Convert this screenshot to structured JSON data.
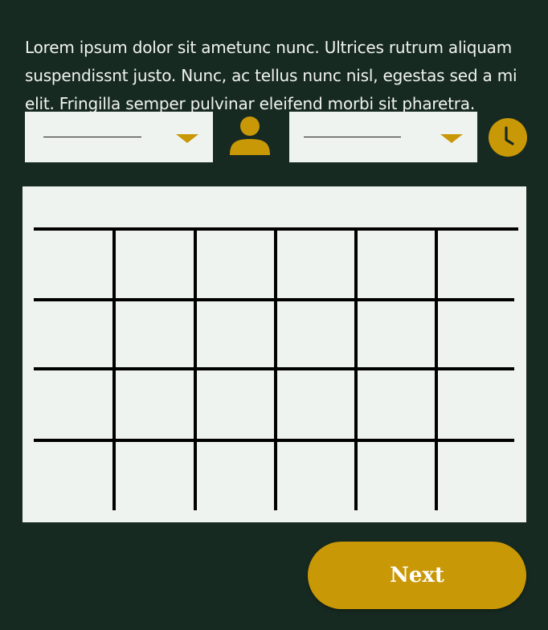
{
  "intro": {
    "text": "Lorem ipsum dolor sit ametunc nunc. Ultrices rutrum aliquam suspendissnt justo. Nunc, ac tellus nunc nisl, egestas sed a mi elit. Fringilla semper pulvinar eleifend morbi sit pharetra."
  },
  "filters": {
    "first_select": {
      "value": "",
      "icon": "chevron-down-icon"
    },
    "person_icon": "user-icon",
    "second_select": {
      "value": "",
      "icon": "chevron-down-icon"
    },
    "clock_icon": "clock-icon"
  },
  "schedule_grid": {
    "columns": 6,
    "rows": 4
  },
  "actions": {
    "next_label": "Next"
  },
  "colors": {
    "background": "#172a22",
    "panel": "#eff3ef",
    "accent": "#c99806",
    "text": "#f1f4f0"
  }
}
